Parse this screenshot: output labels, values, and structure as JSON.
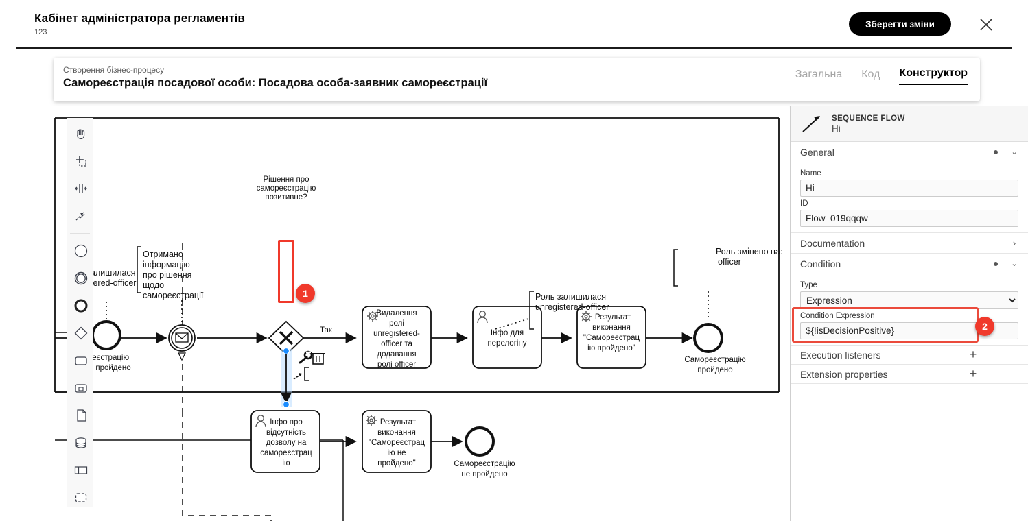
{
  "appbar": {
    "title": "Кабінет адміністратора регламентів",
    "subtitle": "123",
    "save_label": "Зберегти зміни",
    "close_icon": "close-icon"
  },
  "process_card": {
    "breadcrumb": "Створення бізнес-процесу",
    "name": "Самореєстрація посадової особи: Посадова особа-заявник самореєстрації",
    "tabs": [
      {
        "label": "Загальна",
        "active": false
      },
      {
        "label": "Код",
        "active": false
      },
      {
        "label": "Конструктор",
        "active": true
      }
    ]
  },
  "palette": {
    "items": [
      {
        "name": "hand-tool-icon"
      },
      {
        "name": "lasso-tool-icon"
      },
      {
        "name": "space-tool-icon"
      },
      {
        "name": "global-connect-tool-icon"
      },
      {
        "name": "start-event-icon"
      },
      {
        "name": "intermediate-event-icon"
      },
      {
        "name": "end-event-icon"
      },
      {
        "name": "gateway-icon"
      },
      {
        "name": "task-icon"
      },
      {
        "name": "subprocess-icon"
      },
      {
        "name": "data-object-icon"
      },
      {
        "name": "data-store-icon"
      },
      {
        "name": "participant-icon"
      },
      {
        "name": "group-icon"
      }
    ]
  },
  "diagram": {
    "nodes": [
      {
        "id": "msg_start",
        "type": "message-intermediate-event",
        "label": ""
      },
      {
        "id": "gateway",
        "type": "exclusive-gateway",
        "label": "Рішення про самореєстрацію позитивне?"
      },
      {
        "id": "task_remove_role",
        "type": "service-task",
        "label": "Видалення ролі unregistered-officer та додавання ролі officer"
      },
      {
        "id": "task_relogin",
        "type": "user-task",
        "label": "Інфо для перелогіну"
      },
      {
        "id": "task_result_ok",
        "type": "service-task",
        "label": "Результат виконання \"Самореєстрацію пройдено\""
      },
      {
        "id": "end_ok",
        "type": "end-event",
        "label": "Самореєстрацію пройдено"
      },
      {
        "id": "task_no_permission",
        "type": "user-task",
        "label": "Інфо про відсутність дозволу на самореєстрацію"
      },
      {
        "id": "task_result_fail",
        "type": "service-task",
        "label": "Результат виконання \"Самореєстрацію не пройдено\""
      },
      {
        "id": "end_fail",
        "type": "end-event",
        "label": "Самореєстрацію не пройдено"
      },
      {
        "id": "end_left",
        "type": "end-event",
        "label": "...реєстрацію пройдено"
      }
    ],
    "flow_labels": {
      "yes": "Так"
    },
    "annotations": [
      {
        "id": "ann_info",
        "text_lines": [
          "Отримано",
          "інформацію",
          "про рішення",
          "щодо",
          "самореєстрації"
        ]
      },
      {
        "id": "ann_role_changed",
        "text_lines": [
          "Роль змінено на:",
          "officer"
        ]
      },
      {
        "id": "ann_role_kept_right",
        "text_lines": [
          "Роль залишилася",
          "unregistered-officer"
        ]
      },
      {
        "id": "ann_role_kept_left",
        "text_lines": [
          "...алишилася",
          "...tered-officer"
        ]
      }
    ],
    "context_pad": [
      {
        "name": "wrench-icon"
      },
      {
        "name": "trash-icon"
      },
      {
        "name": "connect-icon"
      },
      {
        "name": "text-annotation-icon"
      }
    ]
  },
  "properties": {
    "header": {
      "type": "SEQUENCE FLOW",
      "name": "Hi",
      "icon": "sequence-flow-icon"
    },
    "groups": [
      {
        "title": "General",
        "expanded": true,
        "fields": [
          {
            "label": "Name",
            "value": "Hi",
            "kind": "text"
          },
          {
            "label": "ID",
            "value": "Flow_019qqqw",
            "kind": "text"
          }
        ]
      },
      {
        "title": "Documentation",
        "expanded": false,
        "collapsible_right": true
      },
      {
        "title": "Condition",
        "expanded": true,
        "fields": [
          {
            "label": "Type",
            "value": "Expression",
            "kind": "select",
            "options": [
              "Expression"
            ]
          },
          {
            "label": "Condition Expression",
            "value": "${!isDecisionPositive}",
            "kind": "text",
            "highlighted": true
          }
        ]
      },
      {
        "title": "Execution listeners",
        "action": "+"
      },
      {
        "title": "Extension properties",
        "action": "+"
      }
    ]
  },
  "badges": [
    {
      "id": 1,
      "label": "1"
    },
    {
      "id": 2,
      "label": "2"
    }
  ],
  "colors": {
    "accent_red": "#f0392b",
    "highlight_border": "#eb4b3c",
    "selection_blue": "#1a8cff",
    "panel_bg": "#f6f6f6",
    "button_bg": "#000000"
  }
}
